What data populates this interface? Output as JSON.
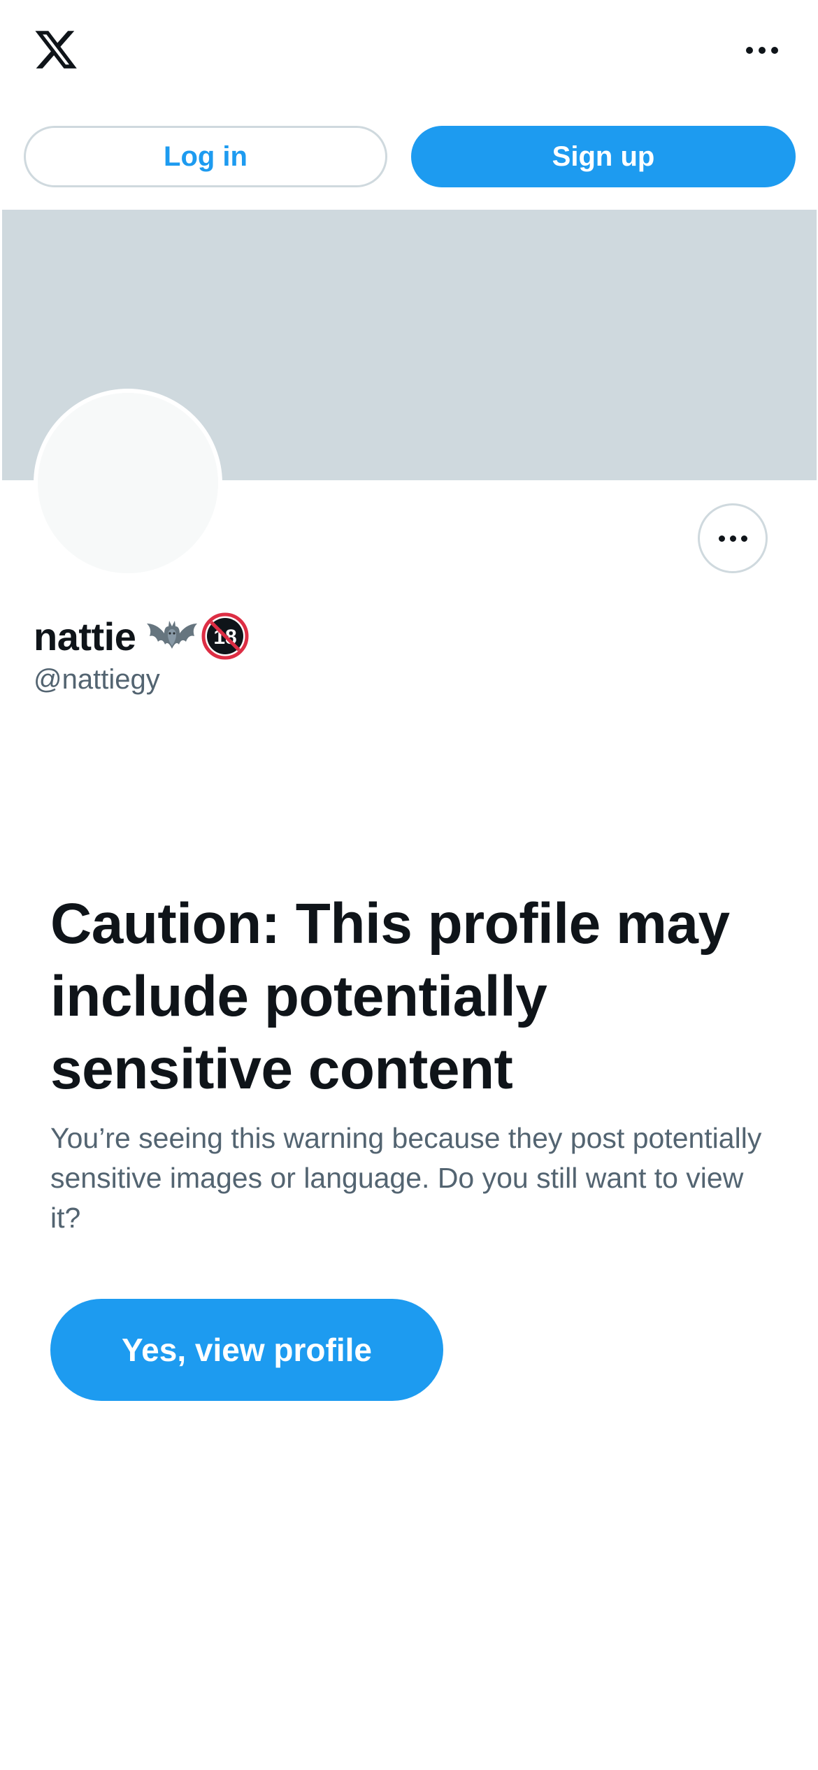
{
  "header": {
    "logo_icon": "x-logo-icon",
    "more_icon": "more-horizontal-icon"
  },
  "auth": {
    "login_label": "Log in",
    "signup_label": "Sign up"
  },
  "profile": {
    "display_name": "nattie",
    "name_emojis": [
      "bat-emoji",
      "no-one-under-eighteen-emoji"
    ],
    "handle": "@nattiegy",
    "more_icon": "more-horizontal-icon"
  },
  "warning": {
    "title": "Caution: This profile may include potentially sensitive content",
    "body": "You’re seeing this warning because they post potentially sensitive images or language. Do you still want to view it?",
    "button_label": "Yes, view profile"
  },
  "colors": {
    "accent": "#1d9bf0",
    "banner": "#cfd9de",
    "text_primary": "#0f1419",
    "text_secondary": "#536471",
    "border": "#cfd9de",
    "avatar_fill": "#f7f9f9"
  }
}
